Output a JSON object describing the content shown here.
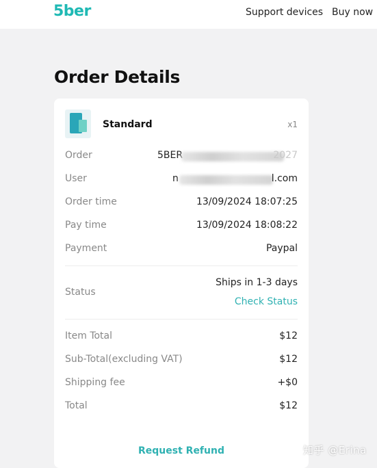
{
  "header": {
    "logo_text": "5ber",
    "nav": {
      "support": "Support devices",
      "buy": "Buy now"
    }
  },
  "page": {
    "title": "Order Details"
  },
  "product": {
    "name": "Standard",
    "quantity": "x1"
  },
  "order_info": {
    "order": {
      "label": "Order",
      "value_prefix": "5BER",
      "value_suffix": "2027"
    },
    "user": {
      "label": "User",
      "value_prefix": "n",
      "value_suffix": "l.com"
    },
    "order_time": {
      "label": "Order time",
      "value": "13/09/2024 18:07:25"
    },
    "pay_time": {
      "label": "Pay time",
      "value": "13/09/2024 18:08:22"
    },
    "payment": {
      "label": "Payment",
      "value": "Paypal"
    }
  },
  "status": {
    "label": "Status",
    "value": "Ships in 1-3 days",
    "check_link": "Check Status"
  },
  "totals": {
    "item_total": {
      "label": "Item Total",
      "value": "$12"
    },
    "sub_total": {
      "label": "Sub-Total(excluding VAT)",
      "value": "$12"
    },
    "shipping": {
      "label": "Shipping fee",
      "value": "+$0"
    },
    "total": {
      "label": "Total",
      "value": "$12"
    }
  },
  "actions": {
    "refund": "Request Refund"
  },
  "watermark": "知乎 @Erina",
  "colors": {
    "accent": "#2fb1b2",
    "logo": "#1fb9b4",
    "background": "#f2f2f3"
  }
}
